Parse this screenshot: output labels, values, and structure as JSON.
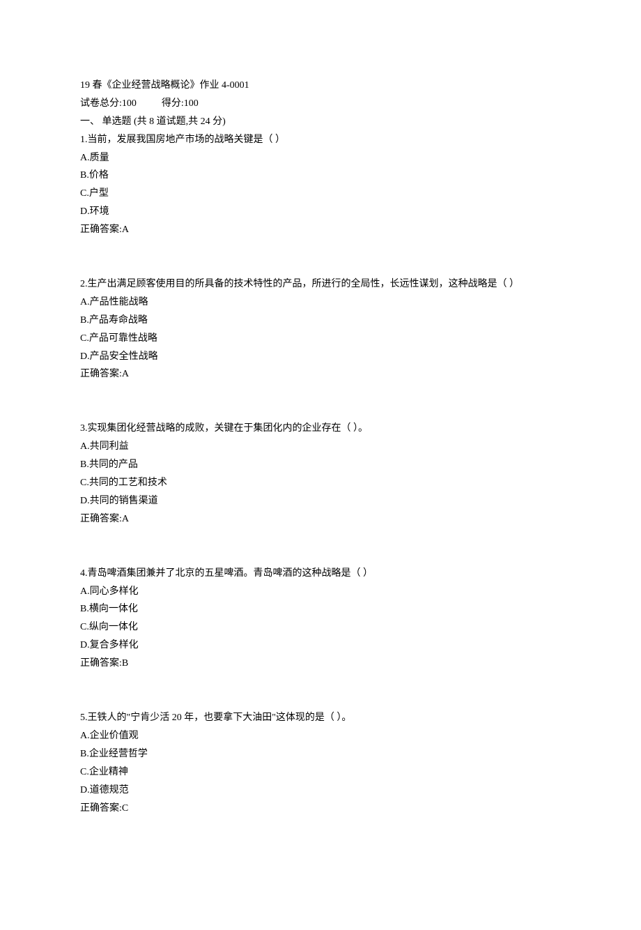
{
  "header": {
    "title": "19 春《企业经营战略概论》作业 4-0001",
    "score_total_label": "试卷总分:100",
    "score_got_label": "得分:100",
    "section_title": "一、  单选题 (共 8 道试题,共 24 分)"
  },
  "questions": [
    {
      "stem": "1.当前，发展我国房地产市场的战略关键是（ ）",
      "options": [
        "A.质量",
        "B.价格",
        "C.户型",
        "D.环境"
      ],
      "answer": "正确答案:A"
    },
    {
      "stem": "2.生产出满足顾客使用目的所具备的技术特性的产品，所进行的全局性，长远性谋划，这种战略是（ ）",
      "options": [
        "A.产品性能战略",
        "B.产品寿命战略",
        "C.产品可靠性战略",
        "D.产品安全性战略"
      ],
      "answer": "正确答案:A"
    },
    {
      "stem": "3.实现集团化经营战略的成败，关键在于集团化内的企业存在（ ）。",
      "options": [
        "A.共同利益",
        "B.共同的产品",
        "C.共同的工艺和技术",
        "D.共同的销售渠道"
      ],
      "answer": "正确答案:A"
    },
    {
      "stem": "4.青岛啤酒集团兼并了北京的五星啤酒。青岛啤酒的这种战略是（ ）",
      "options": [
        "A.同心多样化",
        "B.横向一体化",
        "C.纵向一体化",
        "D.复合多样化"
      ],
      "answer": "正确答案:B"
    },
    {
      "stem": "5.王铁人的\"宁肯少活 20 年，也要拿下大油田\"这体现的是（ ）。",
      "options": [
        "A.企业价值观",
        "B.企业经营哲学",
        "C.企业精神",
        "D.道德规范"
      ],
      "answer": "正确答案:C"
    }
  ]
}
